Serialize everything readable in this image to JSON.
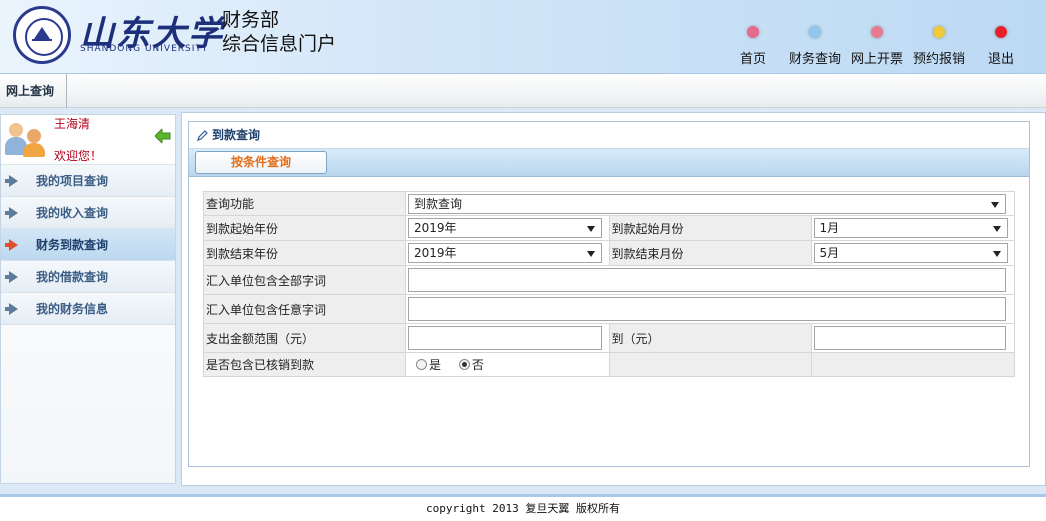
{
  "header": {
    "logo_cn": "山东大学",
    "logo_en": "SHANDONG UNIVERSITY",
    "title_line1": "财务部",
    "title_line2": "综合信息门户",
    "nav": [
      {
        "label": "首页",
        "color": "#e76a8a"
      },
      {
        "label": "财务查询",
        "color": "#8fc8ea"
      },
      {
        "label": "网上开票",
        "color": "#e77a8c"
      },
      {
        "label": "预约报销",
        "color": "#f0c93a"
      },
      {
        "label": "退出",
        "color": "#e8202a"
      }
    ]
  },
  "tabbar": {
    "active_tab": "网上查询"
  },
  "sidebar": {
    "user_name": "王海清",
    "welcome": "欢迎您！",
    "items": [
      {
        "label": "我的项目查询",
        "active": false
      },
      {
        "label": "我的收入查询",
        "active": false
      },
      {
        "label": "财务到款查询",
        "active": true
      },
      {
        "label": "我的借款查询",
        "active": false
      },
      {
        "label": "我的财务信息",
        "active": false
      }
    ]
  },
  "panel": {
    "title": "到款查询",
    "condition_button": "按条件查询"
  },
  "form": {
    "query_function_label": "查询功能",
    "query_function_value": "到款查询",
    "start_year_label": "到款起始年份",
    "start_year_value": "2019年",
    "start_month_label": "到款起始月份",
    "start_month_value": "1月",
    "end_year_label": "到款结束年份",
    "end_year_value": "2019年",
    "end_month_label": "到款结束月份",
    "end_month_value": "5月",
    "all_keywords_label": "汇入单位包含全部字词",
    "any_keywords_label": "汇入单位包含任意字词",
    "amount_range_label": "支出金额范围（元）",
    "amount_to_label": "到（元）",
    "include_written_off_label": "是否包含已核销到款",
    "option_yes": "是",
    "option_no": "否",
    "selected_option": "否"
  },
  "footer": {
    "copyright": "copyright 2013 复旦天翼 版权所有"
  }
}
